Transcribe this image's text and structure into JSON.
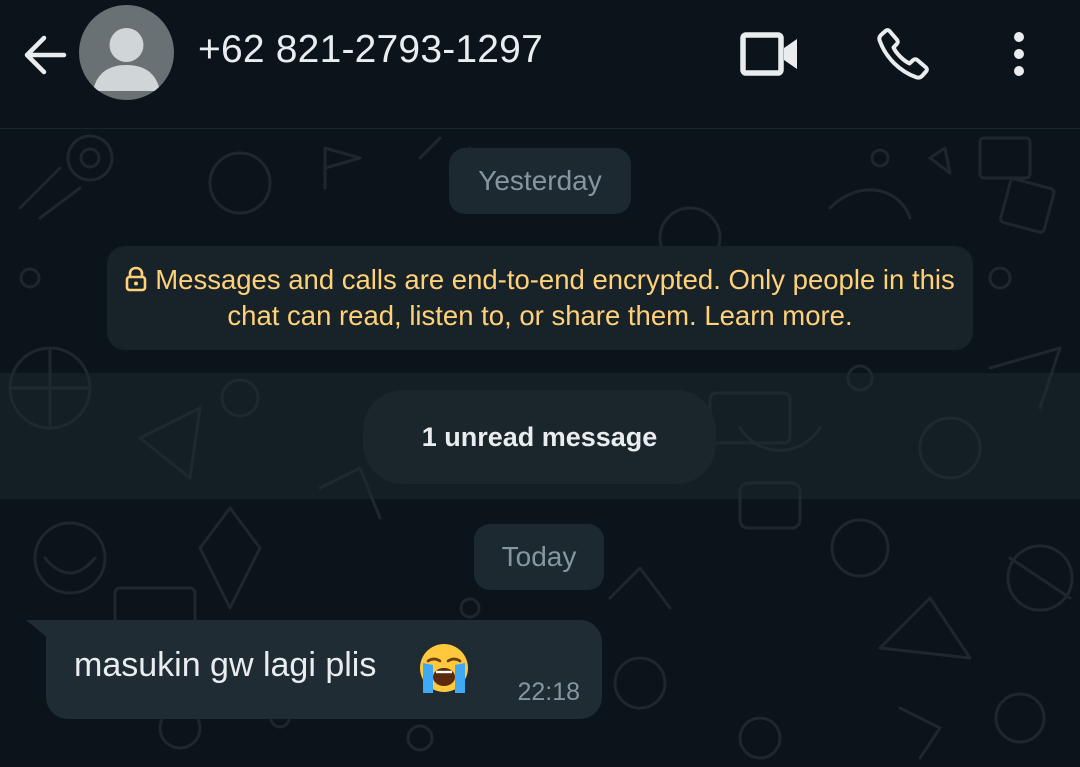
{
  "header": {
    "contact": "+62 821-2793-1297",
    "icons": {
      "back": "arrow-back-icon",
      "avatar": "default-avatar",
      "video": "video-call-icon",
      "call": "phone-icon",
      "menu": "more-vert-icon"
    }
  },
  "chat": {
    "date_yesterday": "Yesterday",
    "encryption_notice": "Messages and calls are end-to-end encrypted. Only people in this chat can read, listen to, or share them. Learn more.",
    "unread_label": "1 unread message",
    "date_today": "Today",
    "messages": [
      {
        "text": "masukin gw lagi plis",
        "emoji": "loudly-crying-face",
        "time": "22:18",
        "direction": "incoming"
      }
    ]
  },
  "colors": {
    "background": "#0b141a",
    "bubble_incoming": "#202c33",
    "notice_text": "#ffd279",
    "muted_text": "#8696a0",
    "primary_text": "#e9edef"
  }
}
